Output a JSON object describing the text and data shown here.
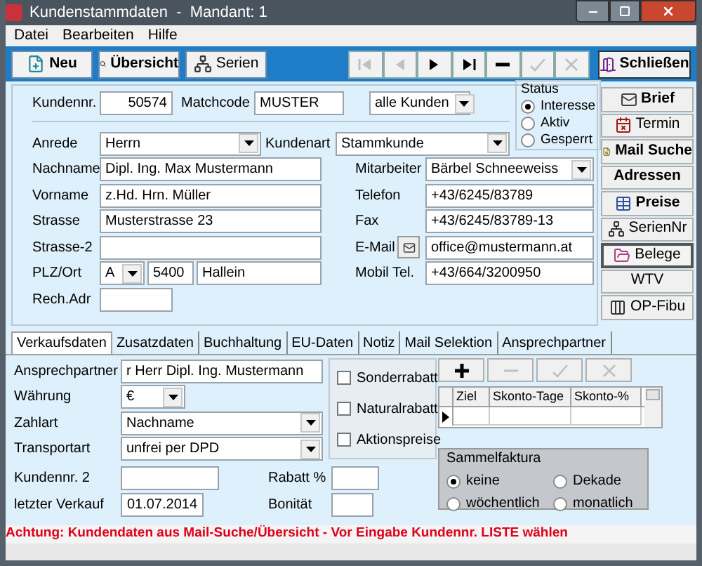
{
  "window": {
    "title": "Kundenstammdaten  -  Mandant: 1"
  },
  "menu": [
    {
      "label": "Datei"
    },
    {
      "label": "Bearbeiten"
    },
    {
      "label": "Hilfe"
    }
  ],
  "toolbar": {
    "buttons": [
      {
        "label": "Neu",
        "kind": "new"
      },
      {
        "label": "Übersicht",
        "kind": "overview"
      },
      {
        "label": "Serien",
        "kind": "series"
      }
    ],
    "navigator": [
      {
        "kind": "first",
        "disabled": true
      },
      {
        "kind": "prev",
        "disabled": true
      },
      {
        "kind": "next",
        "disabled": false
      },
      {
        "kind": "last",
        "disabled": false
      },
      {
        "kind": "delete",
        "disabled": false
      },
      {
        "kind": "post",
        "disabled": true
      },
      {
        "kind": "cancel",
        "disabled": true
      }
    ],
    "close_button": {
      "label": "Schließen"
    }
  },
  "header": {
    "customer_no": {
      "label": "Kundennr.",
      "value": "50574"
    },
    "matchcode": {
      "label": "Matchcode",
      "value": "MUSTER"
    },
    "filter": {
      "value": "alle Kunden"
    },
    "status": {
      "title": "Status",
      "options": [
        {
          "label": "Interesse",
          "selected": true
        },
        {
          "label": "Aktiv",
          "selected": false
        },
        {
          "label": "Gesperrt",
          "selected": false
        }
      ]
    }
  },
  "anrede": {
    "label": "Anrede",
    "value": "Herrn"
  },
  "kundenart": {
    "label": "Kundenart",
    "value": "Stammkunde"
  },
  "left_fields": [
    {
      "kind": "text",
      "label": "Nachname",
      "value": "Dipl. Ing. Max Mustermann"
    },
    {
      "kind": "text",
      "label": "Vorname",
      "value": "z.Hd. Hrn. Müller"
    },
    {
      "kind": "text",
      "label": "Strasse",
      "value": "Musterstrasse 23"
    },
    {
      "kind": "text",
      "label": "Strasse-2"
    },
    {
      "kind": "plz",
      "label": "PLZ/Ort",
      "country": "A",
      "zip": "5400",
      "city": "Hallein"
    },
    {
      "kind": "swatch",
      "label": "Rech.Adr"
    }
  ],
  "right_fields": [
    {
      "kind": "select",
      "label": "Mitarbeiter",
      "value": "Bärbel Schneeweiss"
    },
    {
      "kind": "text",
      "label": "Telefon",
      "value": "+43/6245/83789"
    },
    {
      "kind": "text",
      "label": "Fax",
      "value": "+43/6245/83789-13"
    },
    {
      "kind": "email",
      "label": "E-Mail",
      "value": "office@mustermann.at"
    },
    {
      "kind": "text",
      "label": "Mobil Tel.",
      "value": "+43/664/3200950"
    }
  ],
  "side_buttons": [
    {
      "label": "Brief",
      "bold": true,
      "selected": false
    },
    {
      "label": "Termin",
      "bold": false,
      "selected": false
    },
    {
      "label": "Mail Suche",
      "bold": true,
      "selected": false
    },
    {
      "label": "Adressen",
      "bold": true,
      "selected": false
    },
    {
      "label": "Preise",
      "bold": true,
      "selected": false
    },
    {
      "label": "SerienNr",
      "bold": false,
      "selected": false
    },
    {
      "label": "Belege",
      "bold": false,
      "selected": true
    },
    {
      "label": "WTV",
      "bold": false,
      "selected": false
    },
    {
      "label": "OP-Fibu",
      "bold": false,
      "selected": false
    }
  ],
  "tabs": [
    {
      "label": "Verkaufsdaten",
      "selected": true
    },
    {
      "label": "Zusatzdaten",
      "selected": false
    },
    {
      "label": "Buchhaltung",
      "selected": false
    },
    {
      "label": "EU-Daten",
      "selected": false
    },
    {
      "label": "Notiz",
      "selected": false
    },
    {
      "label": "Mail Selektion",
      "selected": false
    },
    {
      "label": "Ansprechpartner",
      "selected": false
    }
  ],
  "sales": {
    "contact": {
      "label": "Ansprechpartner",
      "value": "r Herr Dipl. Ing. Mustermann"
    },
    "currency": {
      "label": "Währung",
      "value": "€"
    },
    "payment": {
      "label": "Zahlart",
      "value": "Nachname"
    },
    "shipping": {
      "label": "Transportart",
      "value": "unfrei per DPD"
    },
    "customer_no_2": {
      "label": "Kundennr. 2"
    },
    "last_sale": {
      "label": "letzter Verkauf",
      "value": "01.07.2014"
    },
    "discount": {
      "label": "Rabatt %"
    },
    "rating": {
      "label": "Bonität"
    },
    "options": [
      {
        "label": "Sonderrabatt",
        "checked": false
      },
      {
        "label": "Naturalrabatt",
        "checked": false
      },
      {
        "label": "Aktionspreise",
        "checked": false
      }
    ],
    "terms_toolbar": [
      {
        "kind": "add",
        "disabled": false
      },
      {
        "kind": "remove",
        "disabled": true
      },
      {
        "kind": "post",
        "disabled": true
      },
      {
        "kind": "cancel",
        "disabled": true
      }
    ],
    "terms_table": {
      "columns": [
        "Ziel",
        "Skonto-Tage",
        "Skonto-%"
      ]
    },
    "collective_invoice": {
      "title": "Sammelfaktura",
      "options": [
        {
          "label": "keine",
          "selected": true
        },
        {
          "label": "Dekade",
          "selected": false
        },
        {
          "label": "wöchentlich",
          "selected": false
        },
        {
          "label": "monatlich",
          "selected": false
        }
      ]
    }
  },
  "status_bar": {
    "message": "Achtung: Kundendaten aus Mail-Suche/Übersicht - Vor Eingabe Kundennr. LISTE wählen"
  }
}
